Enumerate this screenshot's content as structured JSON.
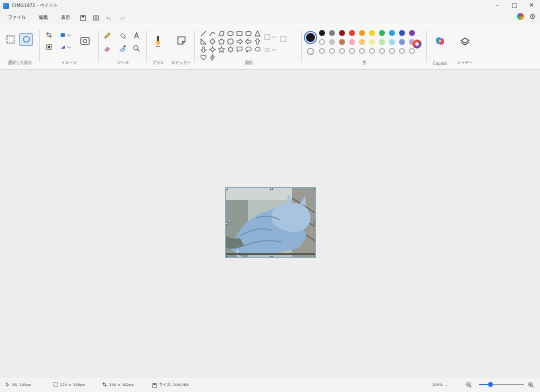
{
  "window": {
    "title": "CIMG1972 - ペイント",
    "controls": [
      "minimize-icon",
      "maximize-icon",
      "close-icon"
    ]
  },
  "menu": {
    "file": "ファイル",
    "edit": "編集",
    "view": "表示",
    "icons": [
      "save-icon",
      "image-icon",
      "undo-icon",
      "redo-icon"
    ],
    "right_icons": [
      "profile-icon",
      "gear-icon"
    ]
  },
  "ribbon": {
    "groups": {
      "selection": "選択した部分",
      "image": "イメージ",
      "tools": "ツール",
      "brushes": "ブラシ",
      "sticker": "ステッカー",
      "shapes": "図形",
      "colors": "色",
      "copilot": "Copilot",
      "layers": "レイヤー"
    },
    "palette": {
      "selected_color": "#1a1a1a",
      "row1": [
        "#1a1a1a",
        "#7f7f7f",
        "#8b1a1a",
        "#e63b2e",
        "#f39c1f",
        "#f4d21f",
        "#2fb55a",
        "#2d9ee0",
        "#2b55c4",
        "#7d3fb3"
      ],
      "row2": [
        "#ffffff",
        "#c3c3c3",
        "#b97a57",
        "#f7a8c4",
        "#f8c76d",
        "#f2ee9a",
        "#b5e6a3",
        "#9ad9ef",
        "#7c96d4",
        "#c0a0dd"
      ]
    }
  },
  "status": {
    "cursor": "58, 145px",
    "selection": "221 × 156px",
    "canvas_size": "294 × 182px",
    "file_size": "サイズ: 106.0KB",
    "zoom": "100%",
    "zoom_level": 0.25
  }
}
